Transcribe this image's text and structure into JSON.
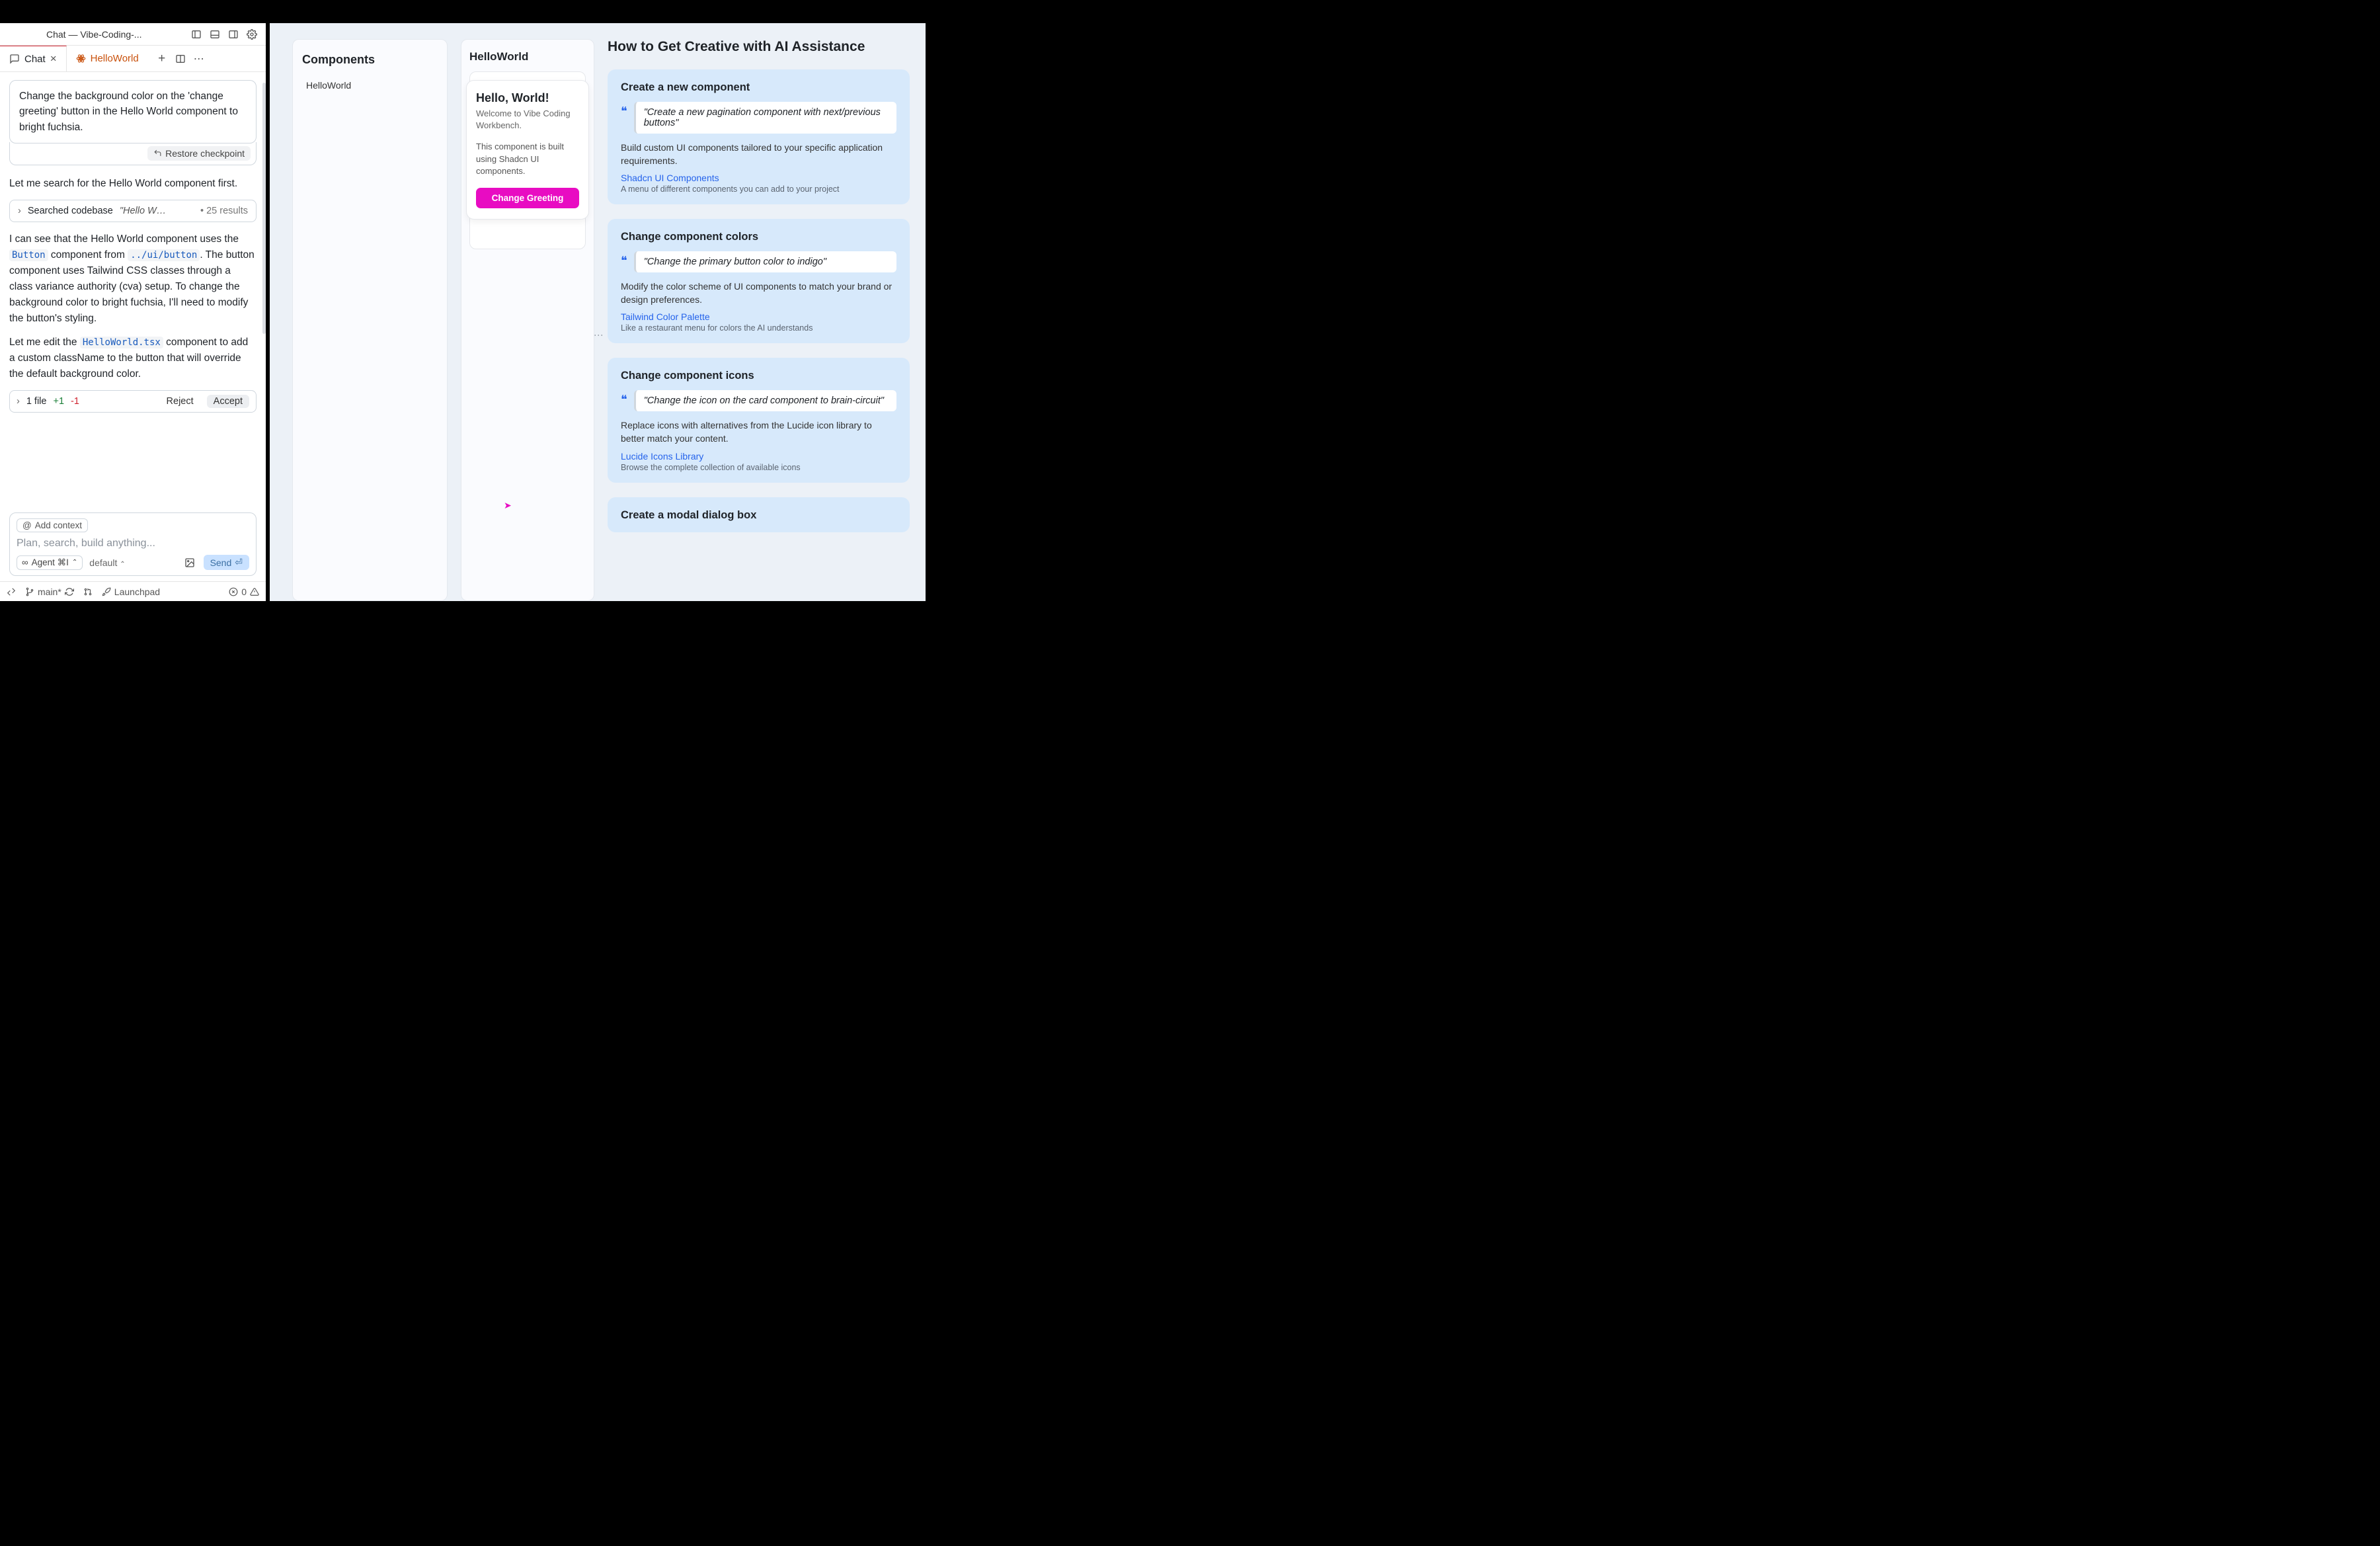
{
  "window": {
    "title": "Chat — Vibe-Coding-..."
  },
  "tabs": {
    "chat_label": "Chat",
    "file_label": "HelloWorld"
  },
  "chat": {
    "user_msg": "Change the background color on the 'change greeting' button in the Hello World component to bright fuchsia.",
    "restore_label": "Restore checkpoint",
    "assist1": "Let me search for the Hello World component first.",
    "search": {
      "label": "Searched codebase",
      "query": "\"Hello W…",
      "count": "• 25 results"
    },
    "assist2_pre": "I can see that the Hello World component uses the ",
    "code1": "Button",
    "assist2_mid": " component from ",
    "code2": "../ui/button",
    "assist2_post": ". The button component uses Tailwind CSS classes through a class variance authority (cva) setup. To change the background color to bright fuchsia, I'll need to modify the button's styling.",
    "assist3_pre": "Let me edit the ",
    "code3": "HelloWorld.tsx",
    "assist3_post": " component to add a custom className to the button that will override the default background color.",
    "diff": {
      "file_count": "1 file",
      "plus": "+1",
      "minus": "-1",
      "reject": "Reject",
      "accept": "Accept"
    }
  },
  "composer": {
    "add_context": "Add context",
    "placeholder": "Plan, search, build anything...",
    "mode": "Agent ⌘I",
    "model": "default",
    "send": "Send"
  },
  "status": {
    "branch": "main*",
    "launchpad": "Launchpad",
    "errors": "0"
  },
  "components": {
    "heading": "Components",
    "items": [
      "HelloWorld"
    ]
  },
  "preview": {
    "heading": "HelloWorld",
    "card_title": "Hello, World!",
    "card_sub": "Welcome to Vibe Coding Workbench.",
    "card_desc": "This component is built using Shadcn UI components.",
    "button": "Change Greeting"
  },
  "help": {
    "title": "How to Get Creative with AI Assistance",
    "cards": [
      {
        "title": "Create a new component",
        "quote": "\"Create a new pagination component with next/previous buttons\"",
        "desc": "Build custom UI components tailored to your specific application requirements.",
        "link": "Shadcn UI Components",
        "sub": "A menu of different components you can add to your project"
      },
      {
        "title": "Change component colors",
        "quote": "\"Change the primary button color to indigo\"",
        "desc": "Modify the color scheme of UI components to match your brand or design preferences.",
        "link": "Tailwind Color Palette",
        "sub": "Like a restaurant menu for colors the AI understands"
      },
      {
        "title": "Change component icons",
        "quote": "\"Change the icon on the card component to brain-circuit\"",
        "desc": "Replace icons with alternatives from the Lucide icon library to better match your content.",
        "link": "Lucide Icons Library",
        "sub": "Browse the complete collection of available icons"
      },
      {
        "title": "Create a modal dialog box",
        "quote": "",
        "desc": "",
        "link": "",
        "sub": ""
      }
    ]
  }
}
